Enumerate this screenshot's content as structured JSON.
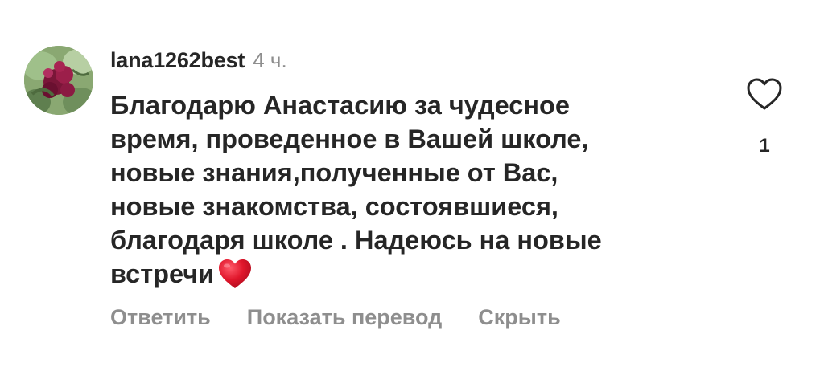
{
  "comment": {
    "username": "lana1262best",
    "timestamp": "4 ч.",
    "lines": [
      "Благодарю Анастасию за чудесное",
      "время, проведенное в Вашей школе,",
      "новые знания,полученные от Вас,",
      "новые знакомства, состоявшиеся,",
      "благодаря школе .  Надеюсь на новые",
      "встречи"
    ],
    "emoji": "red-heart",
    "like_count": "1"
  },
  "actions": {
    "reply": "Ответить",
    "translate": "Показать перевод",
    "hide": "Скрыть"
  },
  "colors": {
    "text": "#262626",
    "secondary": "#8e8e8e",
    "heart_emoji": "#e0162b"
  },
  "icons": {
    "like": "heart-outline-icon",
    "emoji": "red-heart-emoji"
  }
}
